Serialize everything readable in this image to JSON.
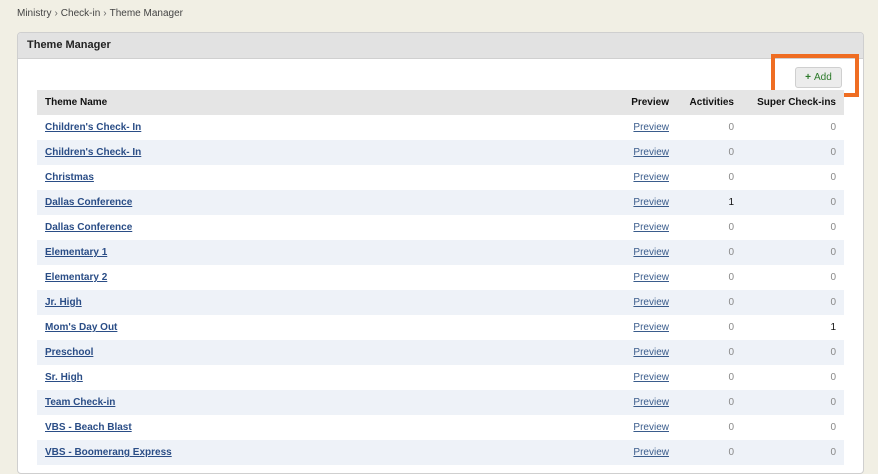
{
  "breadcrumb": [
    "Ministry",
    "Check-in",
    "Theme Manager"
  ],
  "panel": {
    "title": "Theme Manager"
  },
  "toolbar": {
    "add_label": "Add",
    "add_icon": "plus-icon"
  },
  "table": {
    "columns": [
      "Theme Name",
      "Preview",
      "Activities",
      "Super Check-ins"
    ],
    "rows": [
      {
        "name": "Children's Check- In",
        "preview": "Preview",
        "activities": "0",
        "super_checkins": "0"
      },
      {
        "name": "Children's Check- In",
        "preview": "Preview",
        "activities": "0",
        "super_checkins": "0"
      },
      {
        "name": "Christmas",
        "preview": "Preview",
        "activities": "0",
        "super_checkins": "0"
      },
      {
        "name": "Dallas Conference",
        "preview": "Preview",
        "activities": "1",
        "super_checkins": "0"
      },
      {
        "name": "Dallas Conference",
        "preview": "Preview",
        "activities": "0",
        "super_checkins": "0"
      },
      {
        "name": "Elementary 1",
        "preview": "Preview",
        "activities": "0",
        "super_checkins": "0"
      },
      {
        "name": "Elementary 2",
        "preview": "Preview",
        "activities": "0",
        "super_checkins": "0"
      },
      {
        "name": "Jr. High",
        "preview": "Preview",
        "activities": "0",
        "super_checkins": "0"
      },
      {
        "name": "Mom's Day Out",
        "preview": "Preview",
        "activities": "0",
        "super_checkins": "1"
      },
      {
        "name": "Preschool",
        "preview": "Preview",
        "activities": "0",
        "super_checkins": "0"
      },
      {
        "name": "Sr. High",
        "preview": "Preview",
        "activities": "0",
        "super_checkins": "0"
      },
      {
        "name": "Team Check-in",
        "preview": "Preview",
        "activities": "0",
        "super_checkins": "0"
      },
      {
        "name": "VBS - Beach Blast",
        "preview": "Preview",
        "activities": "0",
        "super_checkins": "0"
      },
      {
        "name": "VBS - Boomerang Express",
        "preview": "Preview",
        "activities": "0",
        "super_checkins": "0"
      }
    ]
  },
  "colors": {
    "highlight": "#ef6d22",
    "link": "#2a4d86",
    "add_text": "#2c7a2a",
    "background": "#f1efe4"
  }
}
